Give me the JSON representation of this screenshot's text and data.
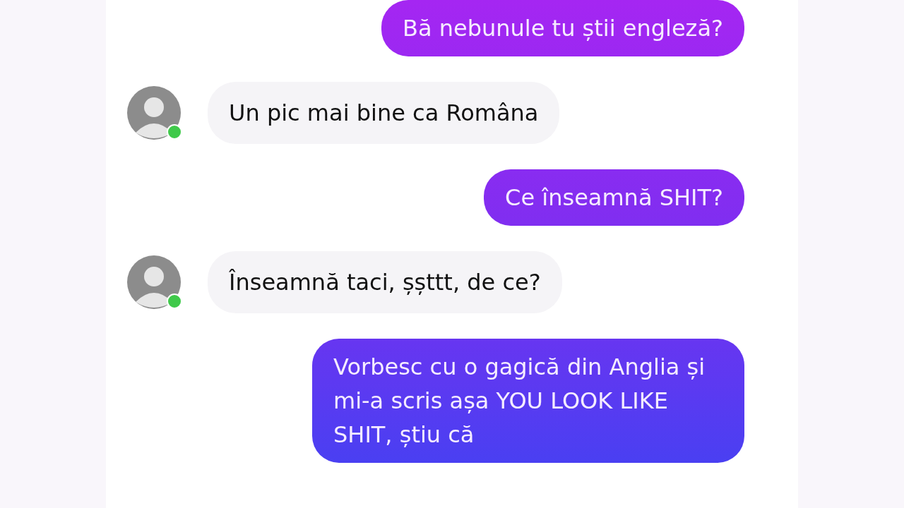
{
  "messages": [
    {
      "kind": "outgoing",
      "text": "Bă nebunule tu știi engleză?"
    },
    {
      "kind": "incoming",
      "online": true,
      "text": "Un pic mai bine ca Româna"
    },
    {
      "kind": "outgoing",
      "text": "Ce înseamnă SHIT?"
    },
    {
      "kind": "incoming",
      "online": true,
      "text": "Înseamnă taci, șșttt, de ce?"
    },
    {
      "kind": "outgoing",
      "text": "Vorbesc cu o gagică din Anglia și mi-a scris așa YOU LOOK LIKE SHIT, știu că"
    }
  ]
}
